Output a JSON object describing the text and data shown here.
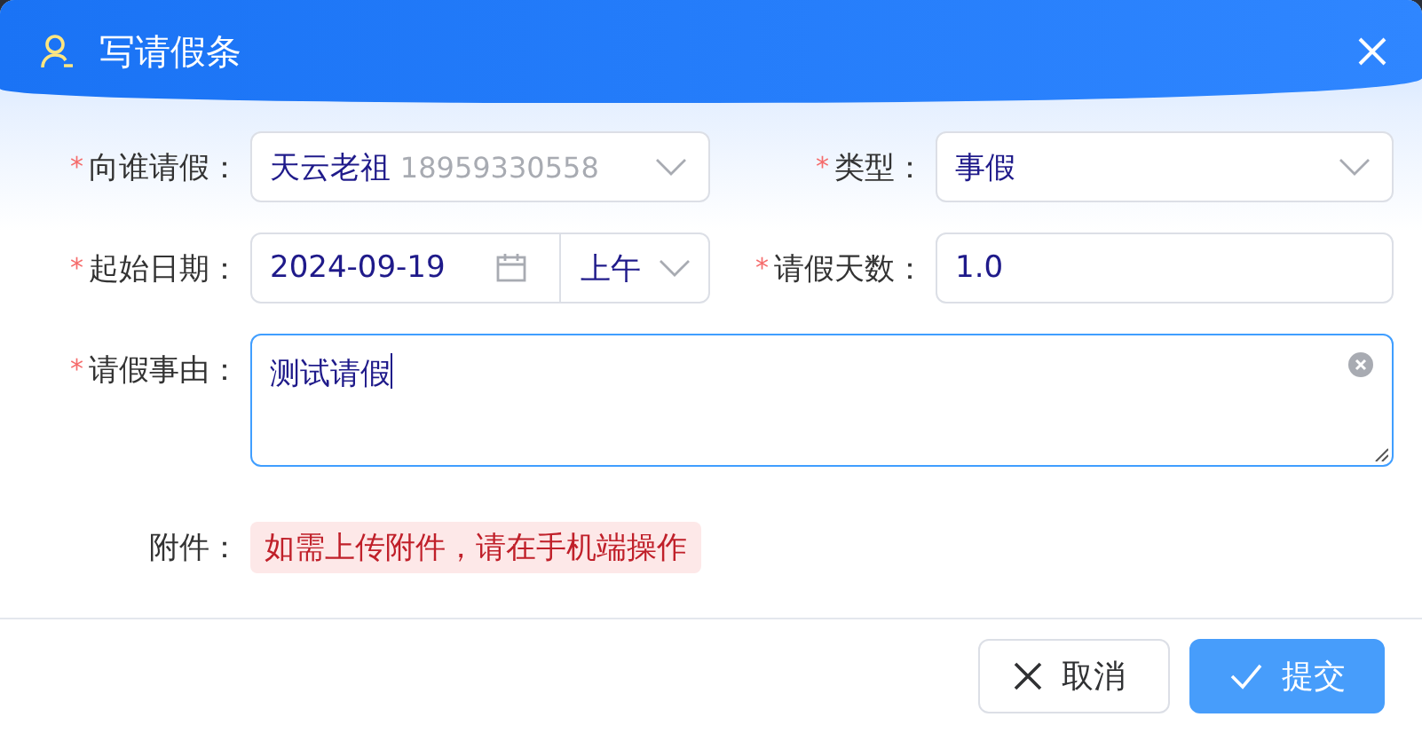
{
  "dialog": {
    "title": "写请假条"
  },
  "fields": [
    {
      "kind": "select",
      "label": "向谁请假：",
      "marker": "*",
      "value": "天云老祖",
      "secondary": "18959330558"
    },
    {
      "kind": "select",
      "label": "类型：",
      "marker": "*",
      "value": "事假"
    },
    {
      "kind": "date",
      "label": "起始日期：",
      "marker": "*",
      "value": "2024-09-19",
      "period": "上午"
    },
    {
      "kind": "text",
      "label": "请假天数：",
      "marker": "*",
      "value": "1.0"
    },
    {
      "kind": "textarea",
      "label": "请假事由：",
      "marker": "*",
      "value": "测试请假",
      "focused": true
    },
    {
      "kind": "note",
      "label": "附件：",
      "value": "如需上传附件，请在手机端操作"
    }
  ],
  "buttons": [
    {
      "kind": "cancel",
      "label": "取消"
    },
    {
      "kind": "primary",
      "label": "提交"
    }
  ]
}
